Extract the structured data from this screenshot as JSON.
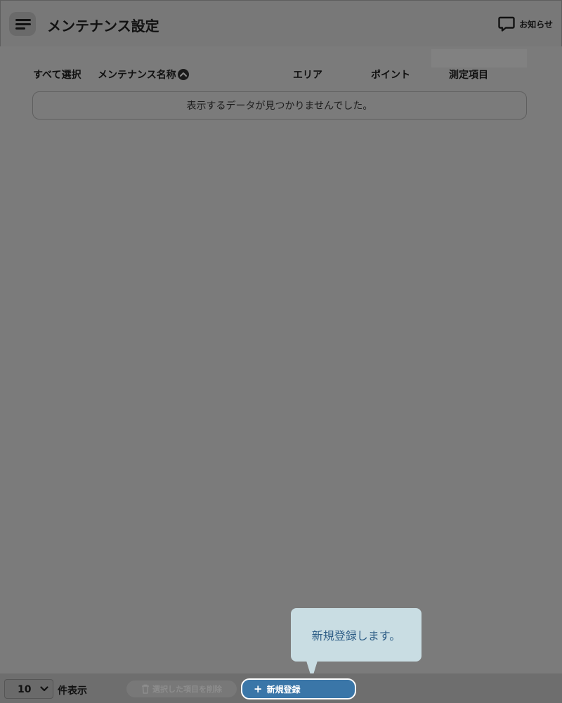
{
  "header": {
    "title": "メンテナンス設定",
    "notice_label": "お知らせ"
  },
  "table": {
    "columns": {
      "select_all": "すべて選択",
      "name": "メンテナンス名称",
      "area": "エリア",
      "point": "ポイント",
      "measure": "測定項目"
    },
    "empty_message": "表示するデータが見つかりませんでした。"
  },
  "footer": {
    "page_size": "10",
    "page_size_label": "件表示",
    "delete_label": "選択した項目を削除",
    "new_label": "新規登録"
  },
  "tooltip": {
    "text": "新規登録します。"
  },
  "colors": {
    "overlay": "#7b7b7b",
    "primary": "#3a76a8",
    "tooltip_bg": "#c9dde3",
    "tooltip_text": "#2d5d86"
  },
  "icons": {
    "menu": "menu-icon",
    "notice": "chat-bubble-icon",
    "sort": "chevron-up-circle-icon",
    "select": "chevron-down-icon",
    "delete": "trash-icon",
    "add": "plus-icon"
  }
}
